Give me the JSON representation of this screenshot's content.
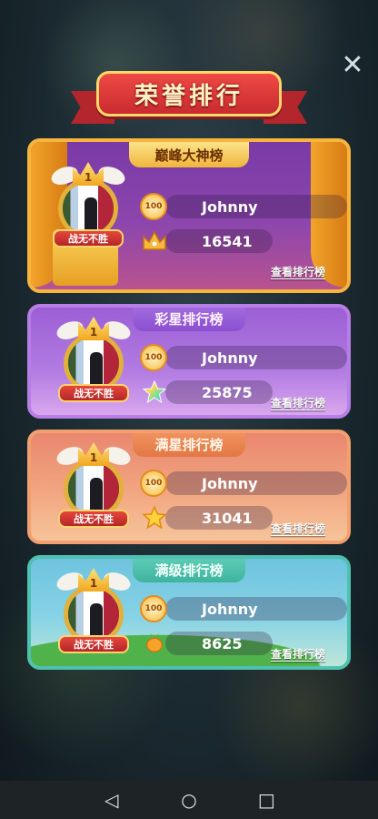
{
  "title": "荣誉排行",
  "close_icon": "close-icon",
  "cards": [
    {
      "tab": "巅峰大神榜",
      "rank": "1",
      "badge": "战无不胜",
      "level": "100",
      "name": "Johnny",
      "score": "16541",
      "score_icon": "crown-icon",
      "link": "查看排行榜"
    },
    {
      "tab": "彩星排行榜",
      "rank": "1",
      "badge": "战无不胜",
      "level": "100",
      "name": "Johnny",
      "score": "25875",
      "score_icon": "rainbow-star-icon",
      "link": "查看排行榜"
    },
    {
      "tab": "满星排行榜",
      "rank": "1",
      "badge": "战无不胜",
      "level": "100",
      "name": "Johnny",
      "score": "31041",
      "score_icon": "gold-star-icon",
      "link": "查看排行榜"
    },
    {
      "tab": "满级排行榜",
      "rank": "1",
      "badge": "战无不胜",
      "level": "100",
      "name": "Johnny",
      "score": "8625",
      "score_icon": "carrot-icon",
      "link": "查看排行榜"
    }
  ],
  "navbar": {
    "back_icon": "back-triangle-icon",
    "home_icon": "home-circle-icon",
    "recents_icon": "recents-square-icon"
  },
  "colors": {
    "card1_border": "#f7b53c",
    "card2_border": "#b77ee6",
    "card3_border": "#f3a070",
    "card4_border": "#4fc1b0",
    "ribbon": "#c82b2f"
  }
}
